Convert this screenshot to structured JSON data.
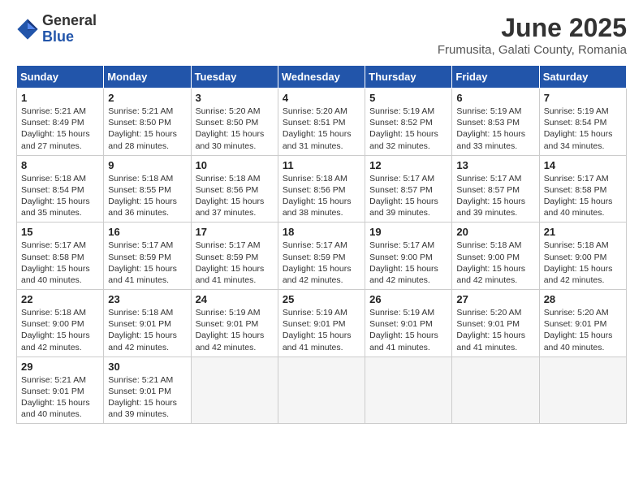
{
  "logo": {
    "general": "General",
    "blue": "Blue"
  },
  "title": "June 2025",
  "subtitle": "Frumusita, Galati County, Romania",
  "headers": [
    "Sunday",
    "Monday",
    "Tuesday",
    "Wednesday",
    "Thursday",
    "Friday",
    "Saturday"
  ],
  "weeks": [
    [
      {
        "day": "1",
        "info": "Sunrise: 5:21 AM\nSunset: 8:49 PM\nDaylight: 15 hours\nand 27 minutes."
      },
      {
        "day": "2",
        "info": "Sunrise: 5:21 AM\nSunset: 8:50 PM\nDaylight: 15 hours\nand 28 minutes."
      },
      {
        "day": "3",
        "info": "Sunrise: 5:20 AM\nSunset: 8:50 PM\nDaylight: 15 hours\nand 30 minutes."
      },
      {
        "day": "4",
        "info": "Sunrise: 5:20 AM\nSunset: 8:51 PM\nDaylight: 15 hours\nand 31 minutes."
      },
      {
        "day": "5",
        "info": "Sunrise: 5:19 AM\nSunset: 8:52 PM\nDaylight: 15 hours\nand 32 minutes."
      },
      {
        "day": "6",
        "info": "Sunrise: 5:19 AM\nSunset: 8:53 PM\nDaylight: 15 hours\nand 33 minutes."
      },
      {
        "day": "7",
        "info": "Sunrise: 5:19 AM\nSunset: 8:54 PM\nDaylight: 15 hours\nand 34 minutes."
      }
    ],
    [
      {
        "day": "8",
        "info": "Sunrise: 5:18 AM\nSunset: 8:54 PM\nDaylight: 15 hours\nand 35 minutes."
      },
      {
        "day": "9",
        "info": "Sunrise: 5:18 AM\nSunset: 8:55 PM\nDaylight: 15 hours\nand 36 minutes."
      },
      {
        "day": "10",
        "info": "Sunrise: 5:18 AM\nSunset: 8:56 PM\nDaylight: 15 hours\nand 37 minutes."
      },
      {
        "day": "11",
        "info": "Sunrise: 5:18 AM\nSunset: 8:56 PM\nDaylight: 15 hours\nand 38 minutes."
      },
      {
        "day": "12",
        "info": "Sunrise: 5:17 AM\nSunset: 8:57 PM\nDaylight: 15 hours\nand 39 minutes."
      },
      {
        "day": "13",
        "info": "Sunrise: 5:17 AM\nSunset: 8:57 PM\nDaylight: 15 hours\nand 39 minutes."
      },
      {
        "day": "14",
        "info": "Sunrise: 5:17 AM\nSunset: 8:58 PM\nDaylight: 15 hours\nand 40 minutes."
      }
    ],
    [
      {
        "day": "15",
        "info": "Sunrise: 5:17 AM\nSunset: 8:58 PM\nDaylight: 15 hours\nand 40 minutes."
      },
      {
        "day": "16",
        "info": "Sunrise: 5:17 AM\nSunset: 8:59 PM\nDaylight: 15 hours\nand 41 minutes."
      },
      {
        "day": "17",
        "info": "Sunrise: 5:17 AM\nSunset: 8:59 PM\nDaylight: 15 hours\nand 41 minutes."
      },
      {
        "day": "18",
        "info": "Sunrise: 5:17 AM\nSunset: 8:59 PM\nDaylight: 15 hours\nand 42 minutes."
      },
      {
        "day": "19",
        "info": "Sunrise: 5:17 AM\nSunset: 9:00 PM\nDaylight: 15 hours\nand 42 minutes."
      },
      {
        "day": "20",
        "info": "Sunrise: 5:18 AM\nSunset: 9:00 PM\nDaylight: 15 hours\nand 42 minutes."
      },
      {
        "day": "21",
        "info": "Sunrise: 5:18 AM\nSunset: 9:00 PM\nDaylight: 15 hours\nand 42 minutes."
      }
    ],
    [
      {
        "day": "22",
        "info": "Sunrise: 5:18 AM\nSunset: 9:00 PM\nDaylight: 15 hours\nand 42 minutes."
      },
      {
        "day": "23",
        "info": "Sunrise: 5:18 AM\nSunset: 9:01 PM\nDaylight: 15 hours\nand 42 minutes."
      },
      {
        "day": "24",
        "info": "Sunrise: 5:19 AM\nSunset: 9:01 PM\nDaylight: 15 hours\nand 42 minutes."
      },
      {
        "day": "25",
        "info": "Sunrise: 5:19 AM\nSunset: 9:01 PM\nDaylight: 15 hours\nand 41 minutes."
      },
      {
        "day": "26",
        "info": "Sunrise: 5:19 AM\nSunset: 9:01 PM\nDaylight: 15 hours\nand 41 minutes."
      },
      {
        "day": "27",
        "info": "Sunrise: 5:20 AM\nSunset: 9:01 PM\nDaylight: 15 hours\nand 41 minutes."
      },
      {
        "day": "28",
        "info": "Sunrise: 5:20 AM\nSunset: 9:01 PM\nDaylight: 15 hours\nand 40 minutes."
      }
    ],
    [
      {
        "day": "29",
        "info": "Sunrise: 5:21 AM\nSunset: 9:01 PM\nDaylight: 15 hours\nand 40 minutes."
      },
      {
        "day": "30",
        "info": "Sunrise: 5:21 AM\nSunset: 9:01 PM\nDaylight: 15 hours\nand 39 minutes."
      },
      {
        "day": "",
        "info": ""
      },
      {
        "day": "",
        "info": ""
      },
      {
        "day": "",
        "info": ""
      },
      {
        "day": "",
        "info": ""
      },
      {
        "day": "",
        "info": ""
      }
    ]
  ]
}
